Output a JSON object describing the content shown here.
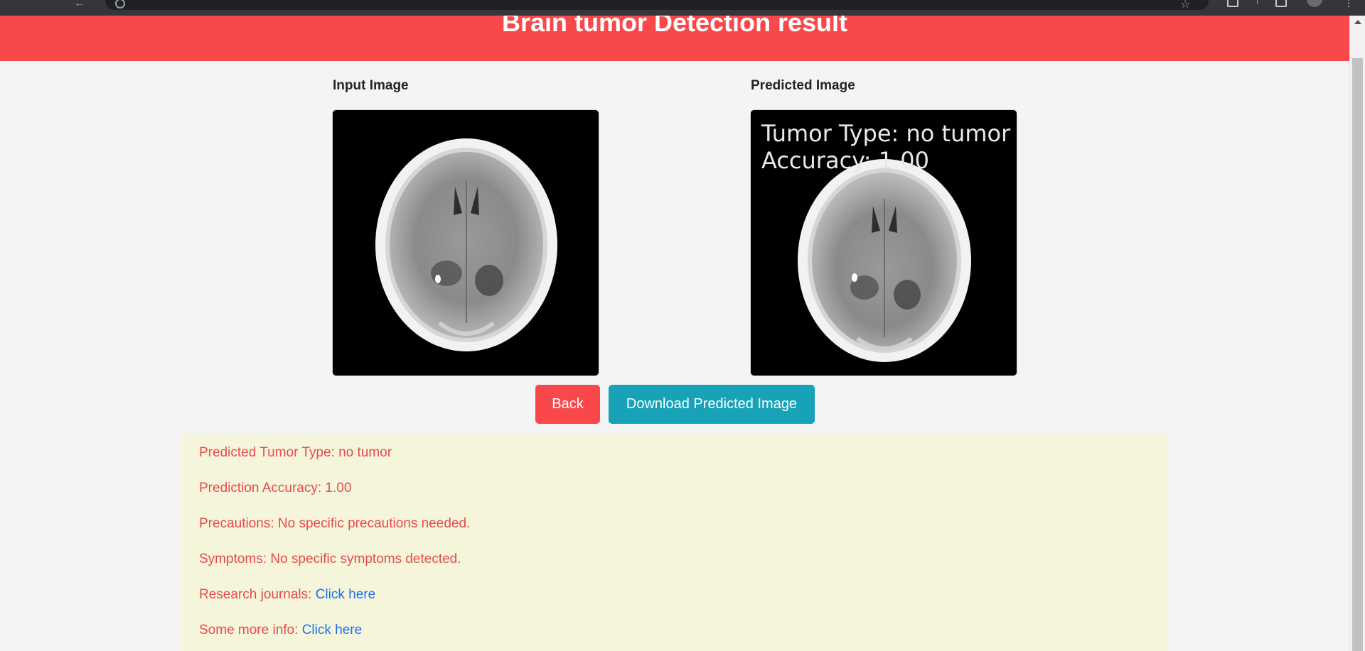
{
  "page": {
    "title": "Brain tumor Detection result"
  },
  "images": {
    "input_label": "Input Image",
    "predicted_label": "Predicted Image",
    "overlay": {
      "line1": "Tumor Type: no tumor",
      "line2": "Accuracy: 1.00"
    }
  },
  "buttons": {
    "back": "Back",
    "download": "Download Predicted Image"
  },
  "results": {
    "tumor_type_label": "Predicted Tumor Type:",
    "tumor_type_value": "no tumor",
    "accuracy_label": "Prediction Accuracy:",
    "accuracy_value": "1.00",
    "precautions_label": "Precautions:",
    "precautions_value": "No specific precautions needed.",
    "symptoms_label": "Symptoms:",
    "symptoms_value": "No specific symptoms detected.",
    "journals_label": "Research journals:",
    "journals_link": "Click here",
    "more_info_label": "Some more info:",
    "more_info_link": "Click here"
  },
  "colors": {
    "header": "#f9484c",
    "back_button": "#f9484c",
    "download_button": "#17a2b8",
    "info_background": "#f5f5dc",
    "info_text": "#e84b4b",
    "link": "#1a73e8"
  },
  "icons": {
    "browser_back": "arrow-left-icon",
    "site_info": "info-icon",
    "bookmark": "star-icon",
    "menu": "kebab-menu-icon"
  }
}
